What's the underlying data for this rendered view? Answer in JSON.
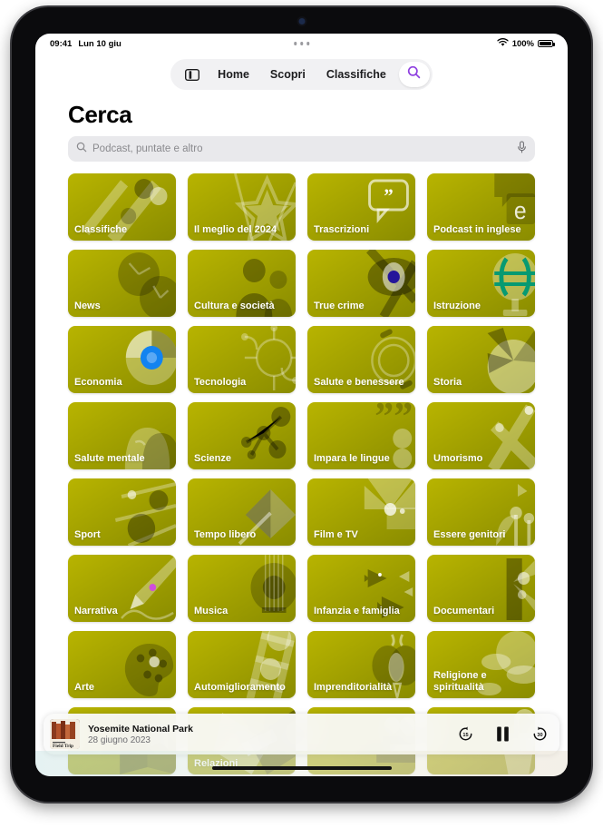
{
  "statusbar": {
    "time": "09:41",
    "date": "Lun 10 giu",
    "battery_percent": "100%",
    "wifi_icon": "wifi-icon",
    "battery_icon": "battery-icon"
  },
  "navbar": {
    "sidebar_icon": "sidebar-toggle-icon",
    "items": [
      {
        "label": "Home"
      },
      {
        "label": "Scopri"
      },
      {
        "label": "Classifiche"
      }
    ],
    "search_icon": "search-icon",
    "search_icon_color": "#8e3fe0"
  },
  "page": {
    "title": "Cerca"
  },
  "search": {
    "placeholder": "Podcast, puntate e altro",
    "value": "",
    "icon": "search-icon",
    "mic_icon": "microphone-icon"
  },
  "grid": {
    "tiles": [
      {
        "label": "Classifiche",
        "art": "charts",
        "c1": "#b8b400",
        "c2": "#8a8c00"
      },
      {
        "label": "Il meglio del 2024",
        "art": "star",
        "c1": "#9d27c7",
        "c2": "#6a1b9e"
      },
      {
        "label": "Trascrizioni",
        "art": "quote-bubble",
        "c1": "#c05ae8",
        "c2": "#a94ae0"
      },
      {
        "label": "Podcast in inglese",
        "art": "speech-e",
        "c1": "#14b2b8",
        "c2": "#039aa4"
      },
      {
        "label": "News",
        "art": "clocks",
        "c1": "#12a5f4",
        "c2": "#1578dc"
      },
      {
        "label": "Cultura e società",
        "art": "people",
        "c1": "#fb5a09",
        "c2": "#e8440a"
      },
      {
        "label": "True crime",
        "art": "eye",
        "c1": "#5b4df0",
        "c2": "#4a33e0"
      },
      {
        "label": "Istruzione",
        "art": "globe",
        "c1": "#10b27c",
        "c2": "#079a72"
      },
      {
        "label": "Economia",
        "art": "piechart",
        "c1": "#1283f0",
        "c2": "#1464e2"
      },
      {
        "label": "Tecnologia",
        "art": "circuit",
        "c1": "#3a6bf2",
        "c2": "#3355e8"
      },
      {
        "label": "Salute e benessere",
        "art": "rings",
        "c1": "#10a0f5",
        "c2": "#0f7fe8"
      },
      {
        "label": "Storia",
        "art": "scroll",
        "c1": "#fa8a08",
        "c2": "#f57208"
      },
      {
        "label": "Salute mentale",
        "art": "heads",
        "c1": "#0f86f0",
        "c2": "#0e62dc"
      },
      {
        "label": "Scienze",
        "art": "molecule",
        "c1": "#18a81a",
        "c2": "#0f8d12"
      },
      {
        "label": "Impara le lingue",
        "art": "quotes-dots",
        "c1": "#16a9a2",
        "c2": "#0c938f"
      },
      {
        "label": "Umorismo",
        "art": "confetti",
        "c1": "#fa9c06",
        "c2": "#f28205"
      },
      {
        "label": "Sport",
        "art": "field",
        "c1": "#74c71a",
        "c2": "#4aa812"
      },
      {
        "label": "Tempo libero",
        "art": "umbrella",
        "c1": "#f520a8",
        "c2": "#dc118f"
      },
      {
        "label": "Film e TV",
        "art": "projector",
        "c1": "#f8456f",
        "c2": "#ef2a60"
      },
      {
        "label": "Essere genitori",
        "art": "plants",
        "c1": "#18a852",
        "c2": "#0d8c44"
      },
      {
        "label": "Narrativa",
        "art": "pen",
        "c1": "#cf4ddc",
        "c2": "#b93bc8"
      },
      {
        "label": "Musica",
        "art": "guitar",
        "c1": "#f42222",
        "c2": "#de1414"
      },
      {
        "label": "Infanzia e famiglia",
        "art": "fish",
        "c1": "#14ab3e",
        "c2": "#089333"
      },
      {
        "label": "Documentari",
        "art": "camera",
        "c1": "#fa6a08",
        "c2": "#f04e06"
      },
      {
        "label": "Arte",
        "art": "palette",
        "c1": "#f85260",
        "c2": "#ea3150"
      },
      {
        "label": "Automiglioramento",
        "art": "ladder",
        "c1": "#10b08a",
        "c2": "#0a9878"
      },
      {
        "label": "Imprenditorialità",
        "art": "bulbs",
        "c1": "#1472f0",
        "c2": "#1258e0"
      },
      {
        "label": "Religione e spiritualità",
        "art": "clouds",
        "c1": "#20a8e8",
        "c2": "#1490d8"
      },
      {
        "label": "",
        "art": "book",
        "c1": "#fb6a08",
        "c2": "#f35208"
      },
      {
        "label": "Relazioni",
        "art": "hands",
        "c1": "#f96d10",
        "c2": "#ee520c"
      },
      {
        "label": "",
        "art": "bench",
        "c1": "#f94560",
        "c2": "#ec2a4e"
      },
      {
        "label": "",
        "art": "podium",
        "c1": "#ddc006",
        "c2": "#c5a904"
      }
    ]
  },
  "nowplaying": {
    "title": "Yosemite National Park",
    "subtitle": "28 giugno 2023",
    "artwork_name": "podcast-artwork",
    "rewind_label": "15",
    "forward_label": "30",
    "rewind_icon": "rewind-15-icon",
    "play_pause_icon": "pause-icon",
    "forward_icon": "forward-30-icon"
  }
}
